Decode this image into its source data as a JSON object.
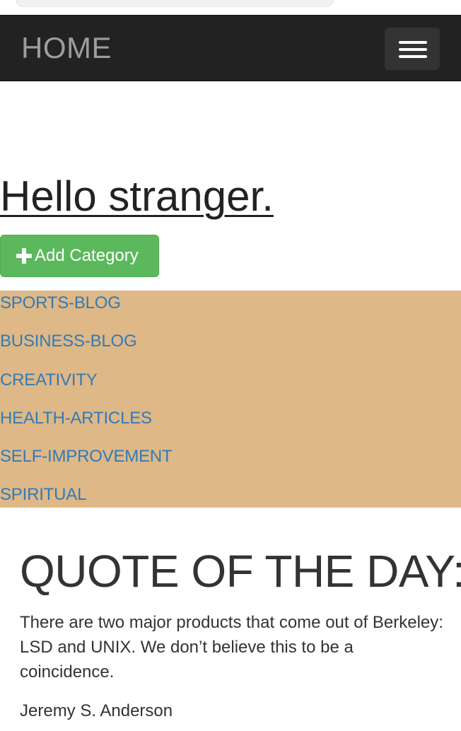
{
  "navbar": {
    "brand": "HOME",
    "toggle_icon": "hamburger-menu-icon"
  },
  "main": {
    "greeting": "Hello stranger.",
    "add_category_label": "Add Category",
    "add_category_icon": "plus-icon"
  },
  "categories": {
    "background": "#deb887",
    "link_color": "#337ab7",
    "items": [
      {
        "label": "SPORTS-BLOG"
      },
      {
        "label": "BUSINESS-BLOG"
      },
      {
        "label": "CREATIVITY"
      },
      {
        "label": "HEALTH-ARTICLES"
      },
      {
        "label": "SELF-IMPROVEMENT"
      },
      {
        "label": "SPIRITUAL"
      }
    ]
  },
  "quote": {
    "title": "QUOTE OF THE DAY:",
    "text": "There are two major products that come out of Berkeley: LSD and UNIX. We don’t believe this to be a coincidence.",
    "author": "Jeremy S. Anderson"
  },
  "colors": {
    "navbar_bg": "#222222",
    "button_green": "#5cb85c"
  }
}
